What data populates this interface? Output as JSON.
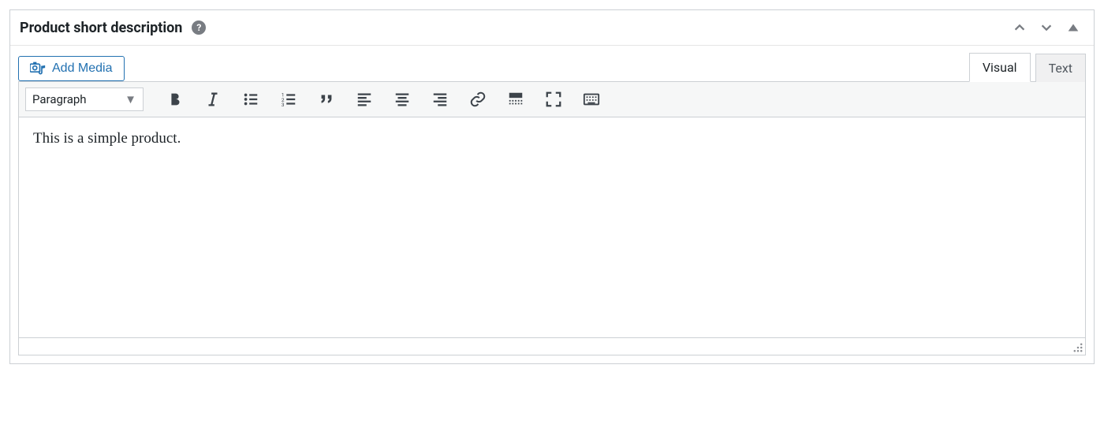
{
  "panel": {
    "title": "Product short description",
    "help_glyph": "?"
  },
  "media_button": {
    "label": "Add Media"
  },
  "tabs": {
    "visual": "Visual",
    "text": "Text"
  },
  "toolbar": {
    "format_label": "Paragraph"
  },
  "editor": {
    "content": "This is a simple product."
  }
}
